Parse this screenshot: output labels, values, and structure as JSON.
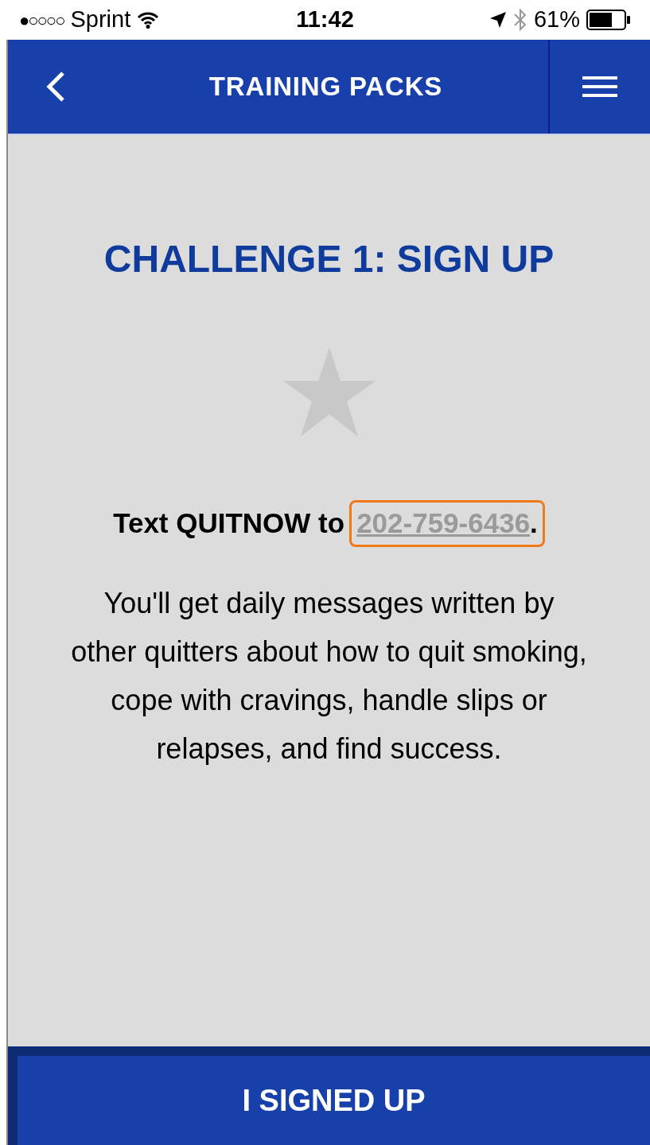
{
  "status_bar": {
    "signal_bars": "●○○○○",
    "carrier": "Sprint",
    "time": "11:42",
    "battery": "61%"
  },
  "header": {
    "title": "TRAINING PACKS"
  },
  "challenge": {
    "title": "CHALLENGE 1: SIGN UP",
    "completed": false,
    "instruction": "Text QUITNOW to",
    "link": "202-759-6436",
    "link_end": ".",
    "link_highlighted": true,
    "description": "You'll get daily messages written by other quitters about how to quit smoking, cope with cravings, handle slips or relapses, and find success."
  },
  "button": {
    "label": "I SIGNED UP"
  }
}
